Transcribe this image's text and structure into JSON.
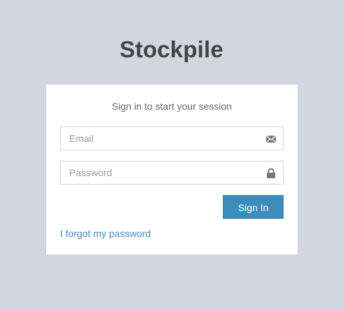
{
  "app": {
    "logo_text": "Stockpile"
  },
  "login": {
    "message": "Sign in to start your session",
    "email": {
      "placeholder": "Email",
      "value": "",
      "icon": "envelope-icon"
    },
    "password": {
      "placeholder": "Password",
      "value": "",
      "icon": "lock-icon"
    },
    "submit_label": "Sign In",
    "forgot_label": "I forgot my password"
  },
  "colors": {
    "page_background": "#d2d6de",
    "box_background": "#ffffff",
    "accent": "#3c8dbc",
    "logo_text": "#444444",
    "muted_text": "#666666",
    "placeholder_text": "#999999",
    "field_border": "#d2d6de"
  }
}
